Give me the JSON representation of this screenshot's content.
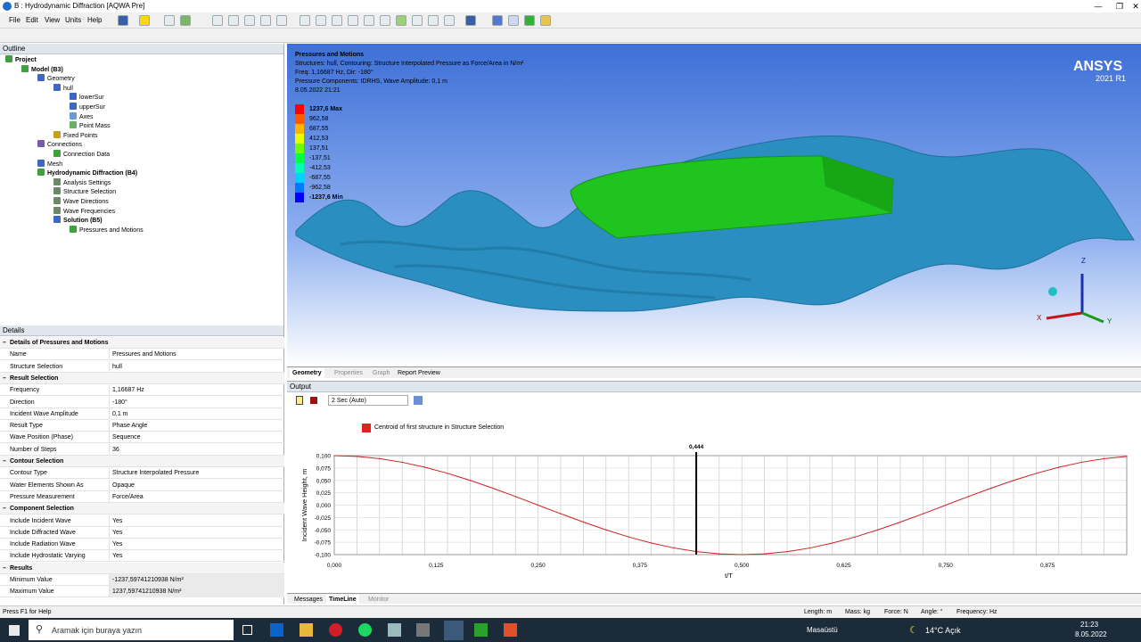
{
  "window": {
    "title": "B : Hydrodynamic Diffraction [AQWA Pre]"
  },
  "menu": [
    "File",
    "Edit",
    "View",
    "Units",
    "Help"
  ],
  "outline": {
    "header": "Outline",
    "tree": [
      {
        "label": "Project",
        "bold": true
      },
      {
        "label": "Model (B3)",
        "bold": true
      },
      {
        "label": "Geometry",
        "bold": false
      },
      {
        "label": "hull",
        "bold": false
      },
      {
        "label": "lowerSur",
        "bold": false
      },
      {
        "label": "upperSur",
        "bold": false
      },
      {
        "label": "Axes",
        "bold": false
      },
      {
        "label": "Point Mass",
        "bold": false
      },
      {
        "label": "Fixed Points",
        "bold": false
      },
      {
        "label": "Connections",
        "bold": false
      },
      {
        "label": "Connection Data",
        "bold": false
      },
      {
        "label": "Mesh",
        "bold": false
      },
      {
        "label": "Hydrodynamic Diffraction (B4)",
        "bold": true
      },
      {
        "label": "Analysis Settings",
        "bold": false
      },
      {
        "label": "Structure Selection",
        "bold": false
      },
      {
        "label": "Wave Directions",
        "bold": false
      },
      {
        "label": "Wave Frequencies",
        "bold": false
      },
      {
        "label": "Solution (B5)",
        "bold": true
      },
      {
        "label": "Pressures and Motions",
        "bold": false
      }
    ]
  },
  "details": {
    "header": "Details",
    "rows": [
      {
        "group": true,
        "k": "Details of Pressures and Motions"
      },
      {
        "k": "Name",
        "v": "Pressures and Motions"
      },
      {
        "k": "Structure Selection",
        "v": "hull"
      },
      {
        "group": true,
        "k": "Result Selection"
      },
      {
        "k": "Frequency",
        "v": "1,16687 Hz"
      },
      {
        "k": "Direction",
        "v": "-180°"
      },
      {
        "k": "Incident Wave Amplitude",
        "v": "0,1 m"
      },
      {
        "k": "Result Type",
        "v": "Phase Angle"
      },
      {
        "k": "Wave Position (Phase)",
        "v": "Sequence"
      },
      {
        "k": "Number of Steps",
        "v": "36"
      },
      {
        "group": true,
        "k": "Contour Selection"
      },
      {
        "k": "Contour Type",
        "v": "Structure Interpolated Pressure"
      },
      {
        "k": "Water Elements Shown As",
        "v": "Opaque"
      },
      {
        "k": "Pressure Measurement",
        "v": "Force/Area"
      },
      {
        "group": true,
        "k": "Component Selection"
      },
      {
        "k": "Include Incident Wave",
        "v": "Yes"
      },
      {
        "k": "Include Diffracted Wave",
        "v": "Yes"
      },
      {
        "k": "Include Radiation Wave",
        "v": "Yes"
      },
      {
        "k": "Include Hydrostatic Varying",
        "v": "Yes"
      },
      {
        "group": true,
        "k": "Results"
      },
      {
        "k": "Minimum Value",
        "v": "-1237,59741210938 N/m²",
        "shade": true
      },
      {
        "k": "Maximum Value",
        "v": "1237,59741210938 N/m²",
        "shade": true
      }
    ]
  },
  "viewport": {
    "title": "Pressures and Motions",
    "lines": [
      "Structures: hull, Contouring: Structure Interpolated Pressure as Force/Area in N/m²",
      "Freq: 1,16687 Hz, Dir: -180°",
      "Pressure Components: IDRHS, Wave Amplitude: 0,1 m",
      "8.05.2022 21:21"
    ],
    "brand": "ANSYS",
    "brand_version": "2021 R1",
    "legend": [
      {
        "label": "1237,6 Max",
        "color": "#ff0000",
        "bold": true
      },
      {
        "label": "962,58",
        "color": "#ff5a00"
      },
      {
        "label": "687,55",
        "color": "#ffb400"
      },
      {
        "label": "412,53",
        "color": "#e6ff00"
      },
      {
        "label": "137,51",
        "color": "#6eff00"
      },
      {
        "label": "-137,51",
        "color": "#00ff3c"
      },
      {
        "label": "-412,53",
        "color": "#00ffb4"
      },
      {
        "label": "-687,55",
        "color": "#00d2ff"
      },
      {
        "label": "-962,58",
        "color": "#0078ff"
      },
      {
        "label": "-1237,6 Min",
        "color": "#0000ff",
        "bold": true
      }
    ],
    "axes": {
      "x": "X",
      "y": "Y",
      "z": "Z"
    }
  },
  "view_tabs": [
    "Geometry",
    "Properties",
    "Graph",
    "Report Preview"
  ],
  "output": {
    "header": "Output",
    "speed": "2 Sec (Auto)",
    "legend_label": "Centroid of first structure in Structure Selection",
    "marker_label": "0,444",
    "ylabel": "Incident Wave Height, m",
    "xlabel": "t/T",
    "yticks": [
      "0,100",
      "0,075",
      "0,050",
      "0,025",
      "0,000",
      "-0,025",
      "-0,050",
      "-0,075",
      "-0,100"
    ],
    "xticks": [
      "0,000",
      "0,125",
      "0,250",
      "0,375",
      "0,500",
      "0,625",
      "0,750",
      "0,875",
      "0,97"
    ]
  },
  "chart_data": {
    "type": "line",
    "title": "",
    "xlabel": "t/T",
    "ylabel": "Incident Wave Height, m",
    "xlim": [
      0,
      0.972
    ],
    "ylim": [
      -0.1,
      0.1
    ],
    "series": [
      {
        "name": "Centroid of first structure in Structure Selection",
        "x": [
          0,
          0.0278,
          0.0556,
          0.0833,
          0.1111,
          0.1389,
          0.1667,
          0.1944,
          0.2222,
          0.25,
          0.2778,
          0.3056,
          0.3333,
          0.3611,
          0.3889,
          0.4167,
          0.4444,
          0.4722,
          0.5,
          0.5278,
          0.5556,
          0.5833,
          0.6111,
          0.6389,
          0.6667,
          0.6944,
          0.7222,
          0.75,
          0.7778,
          0.8056,
          0.8333,
          0.8611,
          0.8889,
          0.9167,
          0.9444,
          0.9722
        ],
        "values": [
          0.1,
          0.0985,
          0.094,
          0.0866,
          0.0766,
          0.0643,
          0.05,
          0.0342,
          0.0174,
          0,
          -0.0174,
          -0.0342,
          -0.05,
          -0.0643,
          -0.0766,
          -0.0866,
          -0.094,
          -0.0985,
          -0.1,
          -0.0985,
          -0.094,
          -0.0866,
          -0.0766,
          -0.0643,
          -0.05,
          -0.0342,
          -0.0174,
          0,
          0.0174,
          0.0342,
          0.05,
          0.0643,
          0.0766,
          0.0866,
          0.094,
          0.0985
        ]
      }
    ],
    "marker_x": 0.444,
    "color": "#cc2222"
  },
  "bottom_tabs": [
    "Messages",
    "TimeLine",
    "Monitor"
  ],
  "status": {
    "help": "Press F1 for Help",
    "length": "Length: m",
    "mass": "Mass: kg",
    "force": "Force: N",
    "angle": "Angle: °",
    "freq": "Frequency: Hz"
  },
  "taskbar": {
    "search": "Aramak için buraya yazın",
    "desktop": "Masaüstü",
    "weather": "14°C  Açık",
    "time": "21:23",
    "date": "8.05.2022"
  }
}
